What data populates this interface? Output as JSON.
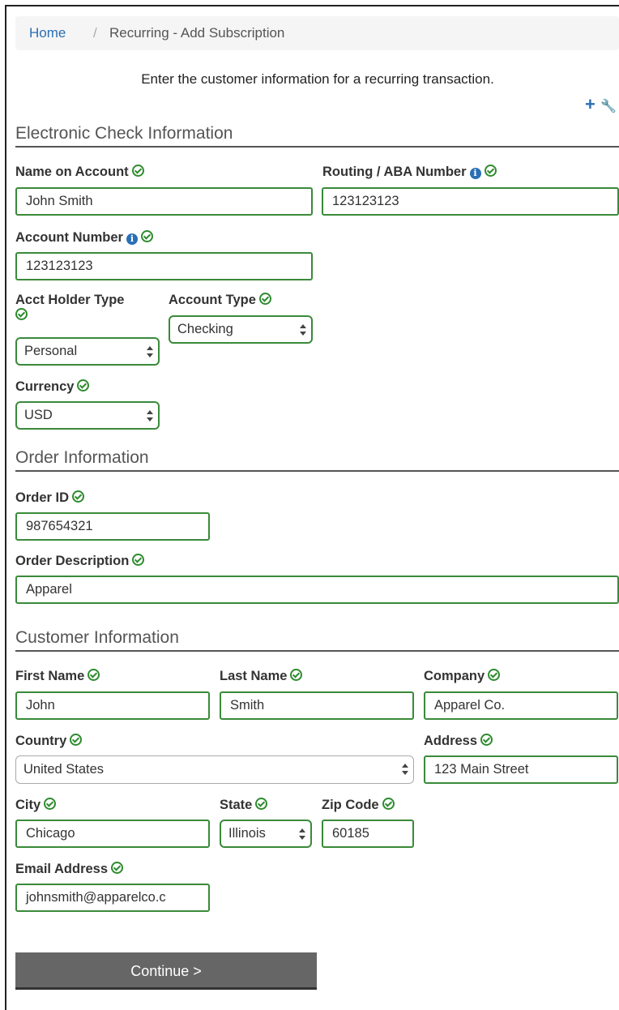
{
  "breadcrumb": {
    "home": "Home",
    "separator": "/",
    "current": "Recurring - Add Subscription"
  },
  "intro": "Enter the customer information for a recurring transaction.",
  "tools": {
    "add": "+",
    "wrench": "🔧"
  },
  "sections": {
    "check": "Electronic Check Information",
    "order": "Order Information",
    "customer": "Customer Information"
  },
  "check": {
    "name_label": "Name on Account",
    "name_value": "John Smith",
    "routing_label": "Routing / ABA Number",
    "routing_value": "123123123",
    "account_label": "Account Number",
    "account_value": "123123123",
    "holder_type_label": "Acct Holder Type",
    "holder_type_value": "Personal",
    "account_type_label": "Account Type",
    "account_type_value": "Checking",
    "currency_label": "Currency",
    "currency_value": "USD"
  },
  "order": {
    "id_label": "Order ID",
    "id_value": "987654321",
    "desc_label": "Order Description",
    "desc_value": "Apparel"
  },
  "customer": {
    "first_label": "First Name",
    "first_value": "John",
    "last_label": "Last Name",
    "last_value": "Smith",
    "company_label": "Company",
    "company_value": "Apparel Co.",
    "country_label": "Country",
    "country_value": "United States",
    "address_label": "Address",
    "address_value": "123 Main Street",
    "city_label": "City",
    "city_value": "Chicago",
    "state_label": "State",
    "state_value": "Illinois",
    "zip_label": "Zip Code",
    "zip_value": "60185",
    "email_label": "Email Address",
    "email_value": "johnsmith@apparelco.c"
  },
  "continue_label": "Continue >",
  "colors": {
    "valid": "#2e8b2e",
    "link": "#2a6fb5",
    "button": "#666666"
  }
}
